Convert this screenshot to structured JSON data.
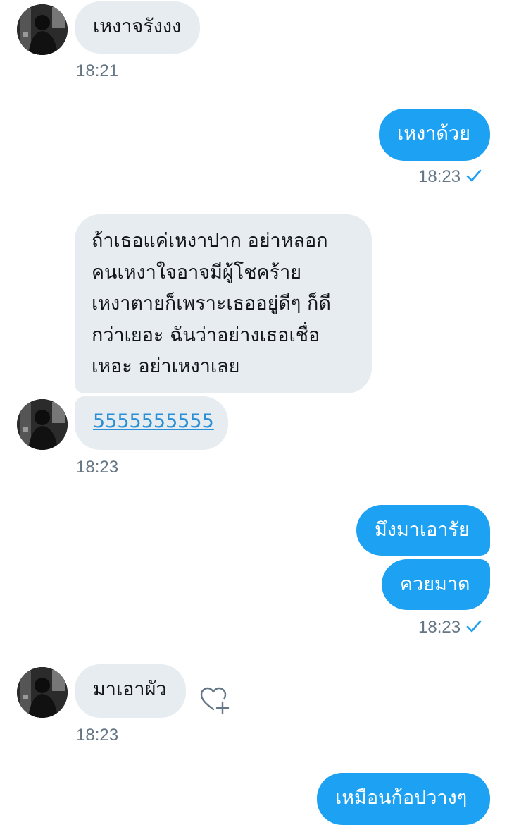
{
  "theme": {
    "sent_bubble_color": "#1da1f2",
    "received_bubble_color": "#e6ecf0",
    "timestamp_color": "#657786",
    "link_color": "#2a8fd6"
  },
  "messages": [
    {
      "id": 1,
      "direction": "received",
      "text": "เหงาจรังงง",
      "time": "18:21"
    },
    {
      "id": 2,
      "direction": "sent",
      "text": "เหงาด้วย",
      "time": "18:23",
      "status_icon": "check-icon"
    },
    {
      "id": 3,
      "direction": "received",
      "lines": [
        "ถ้าเธอแค่เหงาปาก อย่าหลอก",
        "คนเหงาใจอาจมีผู้โชคร้าย",
        "เหงาตายก็เพราะเธออยู่ดีๆ ก็ดี",
        "กว่าเยอะ ฉันว่าอย่างเธอเชื่อ",
        "เหอะ อย่าเหงาเลย"
      ]
    },
    {
      "id": 4,
      "direction": "received",
      "text": "5555555555",
      "is_link": true,
      "time": "18:23"
    },
    {
      "id": 5,
      "direction": "sent",
      "text": "มึงมาเอารัย"
    },
    {
      "id": 6,
      "direction": "sent",
      "text": "ควยมาด",
      "time": "18:23",
      "status_icon": "check-icon"
    },
    {
      "id": 7,
      "direction": "received",
      "text": "มาเอาผัว",
      "time": "18:23",
      "reaction_icon": "heart-plus-icon"
    },
    {
      "id": 8,
      "direction": "sent",
      "text": "เหมือนก้อปวางๆ"
    }
  ]
}
